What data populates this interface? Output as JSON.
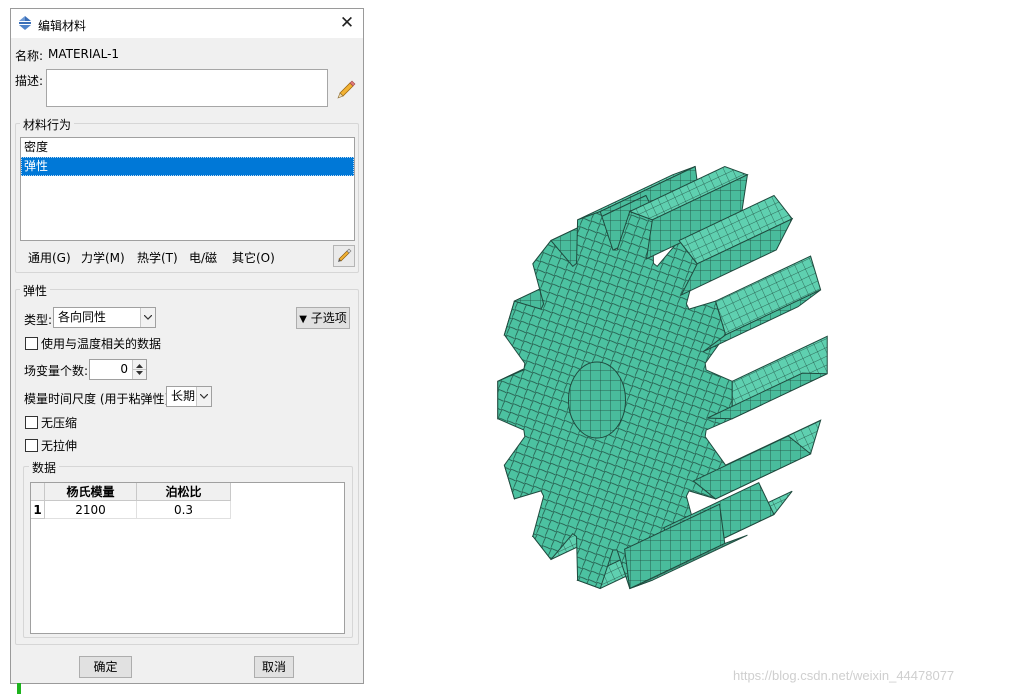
{
  "dialog": {
    "title": "编辑材料",
    "name_label": "名称:",
    "name_value": "MATERIAL-1",
    "desc_label": "描述:",
    "behaviors_group": "材料行为",
    "behaviors": [
      "密度",
      "弹性"
    ],
    "selected_behavior_index": 1,
    "menus": [
      "通用(G)",
      "力学(M)",
      "热学(T)",
      "电/磁",
      "其它(O)"
    ],
    "elastic_group": "弹性",
    "type_label": "类型:",
    "type_value": "各向同性",
    "suboptions_label": "子选项",
    "temp_dependent_label": "使用与温度相关的数据",
    "field_vars_label": "场变量个数:",
    "field_vars_value": "0",
    "timescale_label": "模量时间尺度 (用于粘弹性):",
    "timescale_value": "长期",
    "no_compression_label": "无压缩",
    "no_tension_label": "无拉伸",
    "data_group": "数据",
    "table": {
      "headers": [
        "杨氏模量",
        "泊松比"
      ],
      "rows": [
        {
          "index": "1",
          "cells": [
            "2100",
            "0.3"
          ]
        }
      ]
    },
    "ok_label": "确定",
    "cancel_label": "取消"
  },
  "viewport": {
    "model_color": "#49bc9c",
    "watermark": "https://blog.csdn.net/weixin_44478077"
  }
}
